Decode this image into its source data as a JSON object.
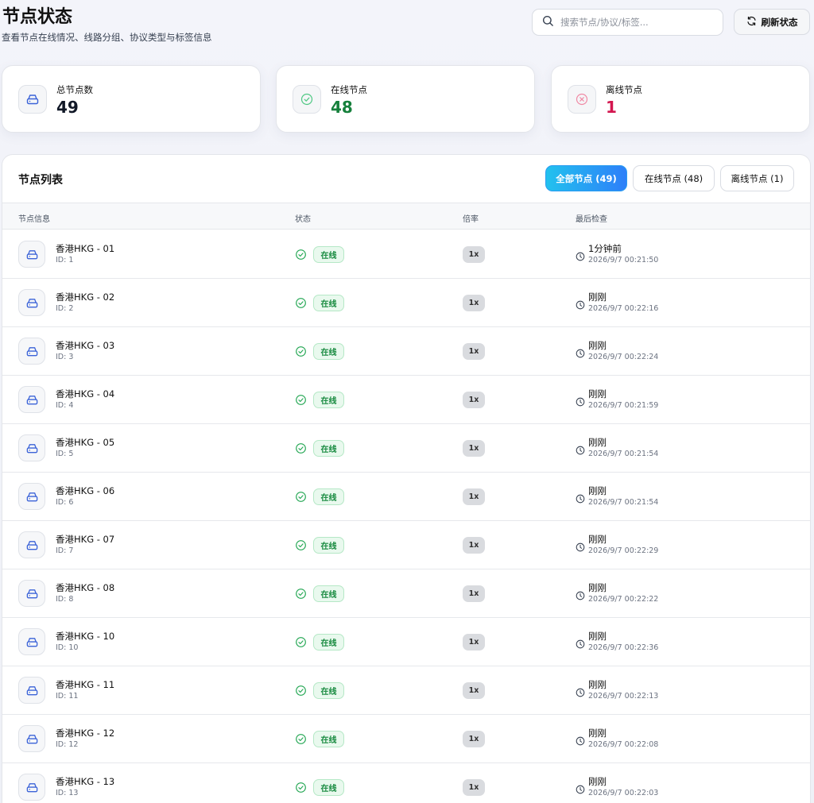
{
  "header": {
    "title": "节点状态",
    "subtitle": "查看节点在线情况、线路分组、协议类型与标签信息",
    "search_placeholder": "搜索节点/协议/标签...",
    "refresh_label": "刷新状态"
  },
  "stats": [
    {
      "label": "总节点数",
      "value": "49",
      "color": "#111827",
      "icon": "server-icon"
    },
    {
      "label": "在线节点",
      "value": "48",
      "color": "#16803c",
      "icon": "check-circle-icon"
    },
    {
      "label": "离线节点",
      "value": "1",
      "color": "#d3164f",
      "icon": "x-circle-icon"
    }
  ],
  "list": {
    "title": "节点列表",
    "filters": [
      {
        "label": "全部节点 (49)",
        "active": true
      },
      {
        "label": "在线节点 (48)",
        "active": false
      },
      {
        "label": "离线节点 (1)",
        "active": false
      }
    ],
    "columns": [
      "节点信息",
      "状态",
      "倍率",
      "最后检查"
    ],
    "rows": [
      {
        "name": "香港HKG - 01",
        "id": "ID: 1",
        "status": "在线",
        "rate": "1x",
        "rel": "1分钟前",
        "abs": "2026/9/7 00:21:50"
      },
      {
        "name": "香港HKG - 02",
        "id": "ID: 2",
        "status": "在线",
        "rate": "1x",
        "rel": "刚刚",
        "abs": "2026/9/7 00:22:16"
      },
      {
        "name": "香港HKG - 03",
        "id": "ID: 3",
        "status": "在线",
        "rate": "1x",
        "rel": "刚刚",
        "abs": "2026/9/7 00:22:24"
      },
      {
        "name": "香港HKG - 04",
        "id": "ID: 4",
        "status": "在线",
        "rate": "1x",
        "rel": "刚刚",
        "abs": "2026/9/7 00:21:59"
      },
      {
        "name": "香港HKG - 05",
        "id": "ID: 5",
        "status": "在线",
        "rate": "1x",
        "rel": "刚刚",
        "abs": "2026/9/7 00:21:54"
      },
      {
        "name": "香港HKG - 06",
        "id": "ID: 6",
        "status": "在线",
        "rate": "1x",
        "rel": "刚刚",
        "abs": "2026/9/7 00:21:54"
      },
      {
        "name": "香港HKG - 07",
        "id": "ID: 7",
        "status": "在线",
        "rate": "1x",
        "rel": "刚刚",
        "abs": "2026/9/7 00:22:29"
      },
      {
        "name": "香港HKG - 08",
        "id": "ID: 8",
        "status": "在线",
        "rate": "1x",
        "rel": "刚刚",
        "abs": "2026/9/7 00:22:22"
      },
      {
        "name": "香港HKG - 10",
        "id": "ID: 10",
        "status": "在线",
        "rate": "1x",
        "rel": "刚刚",
        "abs": "2026/9/7 00:22:36"
      },
      {
        "name": "香港HKG - 11",
        "id": "ID: 11",
        "status": "在线",
        "rate": "1x",
        "rel": "刚刚",
        "abs": "2026/9/7 00:22:13"
      },
      {
        "name": "香港HKG - 12",
        "id": "ID: 12",
        "status": "在线",
        "rate": "1x",
        "rel": "刚刚",
        "abs": "2026/9/7 00:22:08"
      },
      {
        "name": "香港HKG - 13",
        "id": "ID: 13",
        "status": "在线",
        "rate": "1x",
        "rel": "刚刚",
        "abs": "2026/9/7 00:22:03"
      }
    ]
  }
}
